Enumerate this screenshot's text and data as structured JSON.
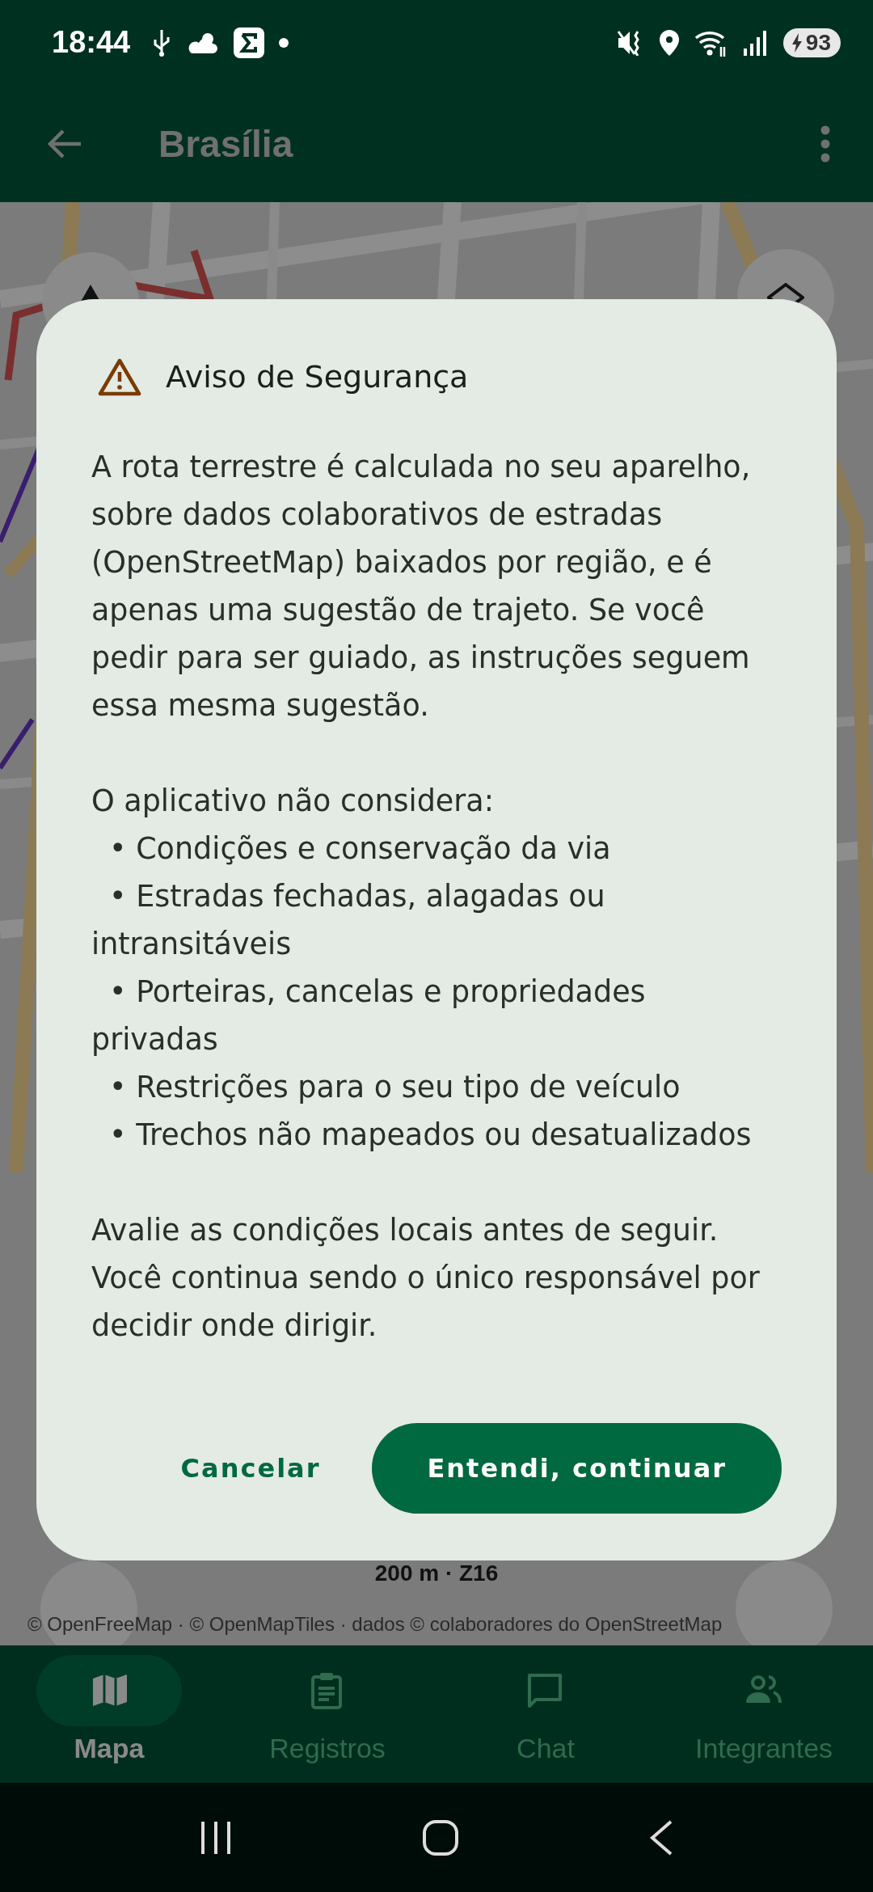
{
  "status_bar": {
    "time": "18:44",
    "battery": "93"
  },
  "app_bar": {
    "title": "Brasília"
  },
  "map": {
    "scale": "200 m · Z16",
    "attribution": "© OpenFreeMap · © OpenMapTiles · dados © colaboradores do OpenStreetMap"
  },
  "dialog": {
    "title": "Aviso de Segurança",
    "intro": "A rota terrestre é calculada no seu aparelho, sobre dados colaborativos de estradas (OpenStreetMap) baixados por região, e é apenas uma sugestão de trajeto. Se você pedir para ser guiado, as instruções seguem essa mesma sugestão.",
    "list_heading": "O aplicativo não considera:",
    "bullets": [
      "• Condições e conservação da via",
      "• Estradas fechadas, alagadas ou intransitáveis",
      "• Porteiras, cancelas e propriedades privadas",
      "• Restrições para o seu tipo de veículo",
      "• Trechos não mapeados ou desatualizados"
    ],
    "closing": "Avalie as condições locais antes de seguir. Você continua sendo o único responsável por decidir onde dirigir.",
    "buttons": [
      {
        "label": "Cancelar",
        "kind": "text"
      },
      {
        "label": "Entendi, continuar",
        "kind": "filled"
      }
    ]
  },
  "bottom_nav": [
    {
      "label": "Mapa",
      "selected": true
    },
    {
      "label": "Registros",
      "selected": false
    },
    {
      "label": "Chat",
      "selected": false
    },
    {
      "label": "Integrantes",
      "selected": false
    }
  ]
}
